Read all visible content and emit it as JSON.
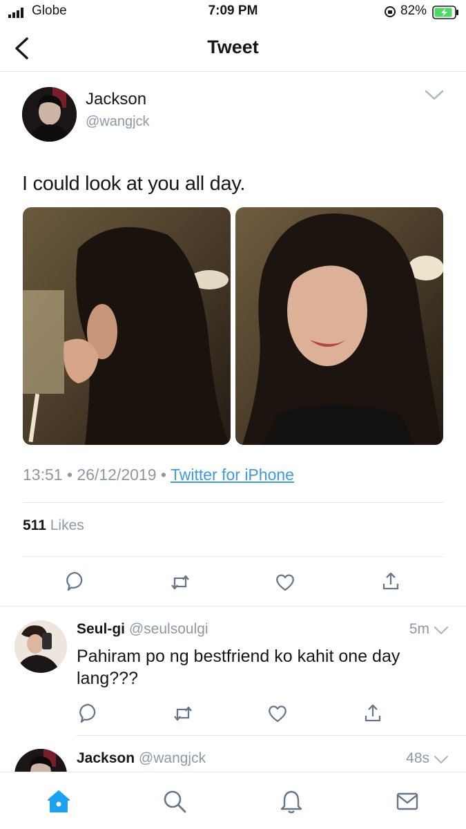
{
  "status_bar": {
    "carrier": "Globe",
    "time": "7:09 PM",
    "battery_percent": "82%"
  },
  "header": {
    "title": "Tweet"
  },
  "tweet": {
    "author_name": "Jackson",
    "author_handle": "@wangjck",
    "text": "I could look at you all day.",
    "time": "13:51",
    "date": "26/12/2019",
    "source": "Twitter for iPhone",
    "separator": "•",
    "likes_count": "511",
    "likes_label": "Likes"
  },
  "replies": [
    {
      "name": "Seul-gi",
      "handle": "@seulsoulgi",
      "time": "5m",
      "text": "Pahiram po ng bestfriend ko kahit one day lang???"
    },
    {
      "name": "Jackson",
      "handle": "@wangjck",
      "time": "48s"
    }
  ],
  "icons": {
    "accent_color": "#1da1f2",
    "action_icons": [
      "reply-icon",
      "retweet-icon",
      "like-icon",
      "share-icon"
    ],
    "tab_icons": [
      "home-icon",
      "search-icon",
      "notifications-icon",
      "messages-icon"
    ]
  }
}
